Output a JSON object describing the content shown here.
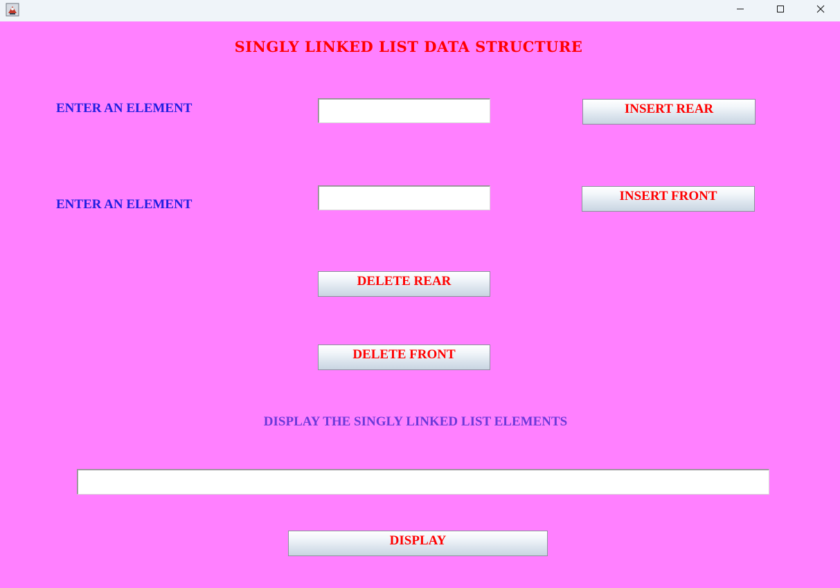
{
  "window": {
    "controls": {
      "minimize_icon": "minimize-icon",
      "maximize_icon": "maximize-icon",
      "close_icon": "close-icon"
    }
  },
  "heading": "SINGLY LINKED LIST DATA STRUCTURE",
  "insert_rear": {
    "label": "ENTER AN ELEMENT",
    "input_value": "",
    "button_label": "INSERT REAR"
  },
  "insert_front": {
    "label": "ENTER AN ELEMENT",
    "input_value": "",
    "button_label": "INSERT FRONT"
  },
  "delete_rear_label": "DELETE REAR",
  "delete_front_label": "DELETE FRONT",
  "display_section": {
    "label": "DISPLAY THE SINGLY LINKED LIST ELEMENTS",
    "output_value": "",
    "button_label": "DISPLAY"
  },
  "colors": {
    "background": "#ff80ff",
    "heading": "#ff0000",
    "field_label": "#1f1fe0",
    "button_text": "#ff0000",
    "display_label": "#6b39d8"
  }
}
